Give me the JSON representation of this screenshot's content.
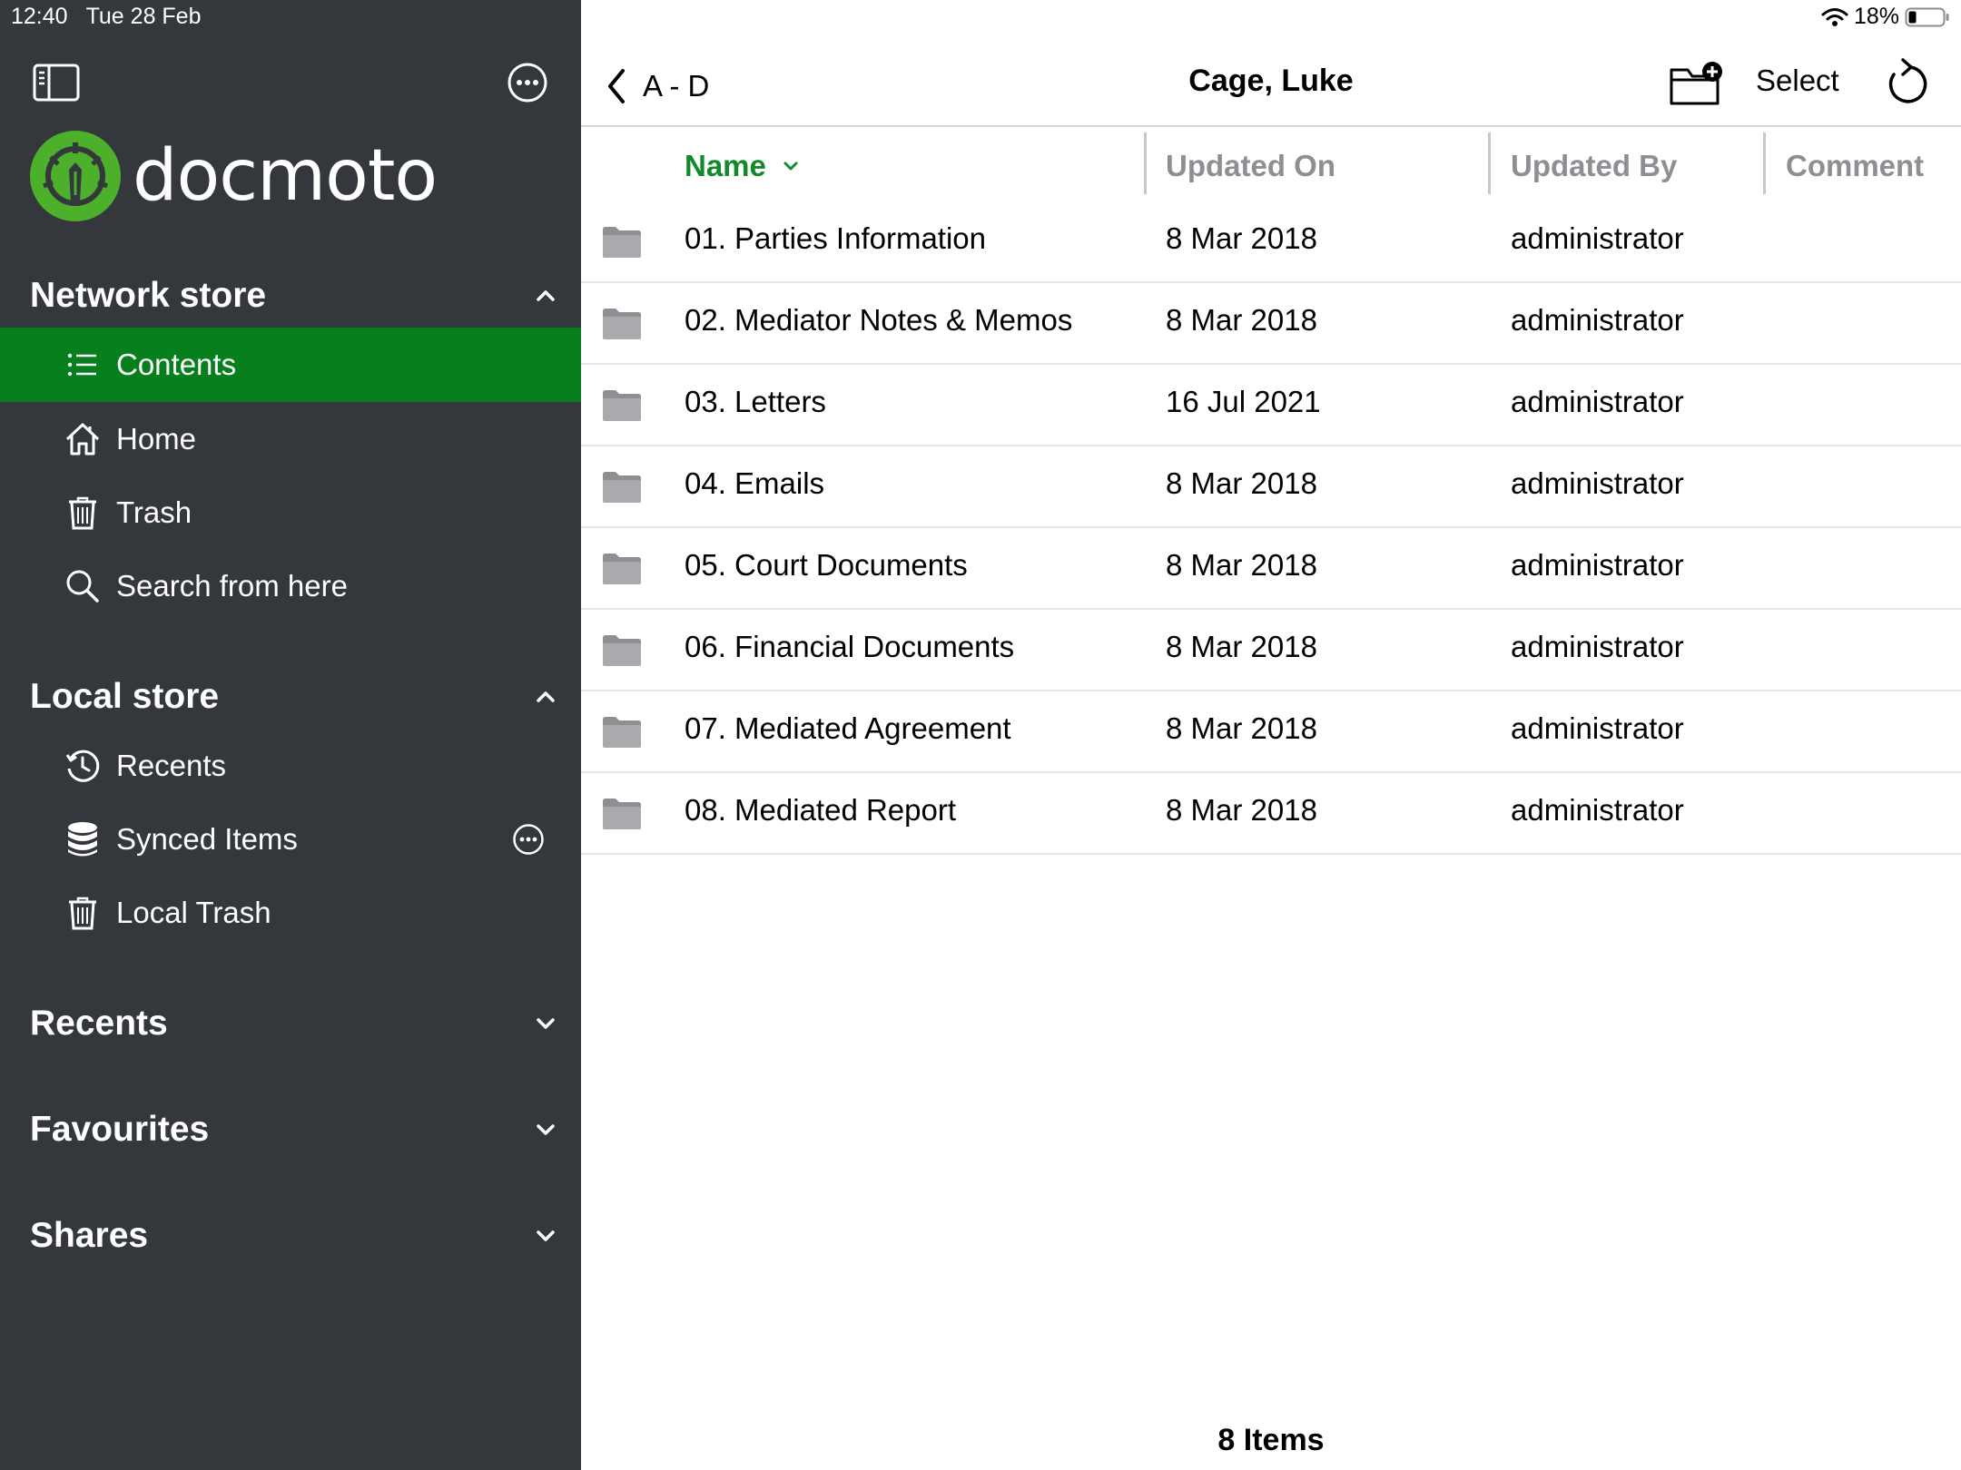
{
  "status": {
    "time": "12:40",
    "date": "Tue 28 Feb",
    "battery": "18%"
  },
  "brand": {
    "name": "docmoto",
    "accent": "#067f1c",
    "sidebar_bg": "#34373c"
  },
  "sidebar": {
    "network_store": {
      "title": "Network store",
      "items": [
        {
          "label": "Contents",
          "icon": "list-icon",
          "active": true
        },
        {
          "label": "Home",
          "icon": "home-icon"
        },
        {
          "label": "Trash",
          "icon": "trash-icon"
        },
        {
          "label": "Search from here",
          "icon": "search-icon"
        }
      ]
    },
    "local_store": {
      "title": "Local store",
      "items": [
        {
          "label": "Recents",
          "icon": "history-icon"
        },
        {
          "label": "Synced Items",
          "icon": "database-icon"
        },
        {
          "label": "Local Trash",
          "icon": "trash-icon"
        }
      ]
    },
    "recents": {
      "title": "Recents"
    },
    "favourites": {
      "title": "Favourites"
    },
    "shares": {
      "title": "Shares"
    }
  },
  "toolbar": {
    "back_label": "A - D",
    "title": "Cage, Luke",
    "select_label": "Select"
  },
  "table": {
    "columns": [
      "Name",
      "Updated On",
      "Updated By",
      "Comment"
    ],
    "sorted_column": "Name",
    "rows": [
      {
        "name": "01. Parties Information",
        "updated_on": "8 Mar 2018",
        "updated_by": "administrator",
        "comment": ""
      },
      {
        "name": "02. Mediator Notes & Memos",
        "updated_on": "8 Mar 2018",
        "updated_by": "administrator",
        "comment": ""
      },
      {
        "name": "03. Letters",
        "updated_on": "16 Jul 2021",
        "updated_by": "administrator",
        "comment": ""
      },
      {
        "name": "04. Emails",
        "updated_on": "8 Mar 2018",
        "updated_by": "administrator",
        "comment": ""
      },
      {
        "name": "05. Court Documents",
        "updated_on": "8 Mar 2018",
        "updated_by": "administrator",
        "comment": ""
      },
      {
        "name": "06. Financial Documents",
        "updated_on": "8 Mar 2018",
        "updated_by": "administrator",
        "comment": ""
      },
      {
        "name": "07. Mediated Agreement",
        "updated_on": "8 Mar 2018",
        "updated_by": "administrator",
        "comment": ""
      },
      {
        "name": "08. Mediated Report",
        "updated_on": "8 Mar 2018",
        "updated_by": "administrator",
        "comment": ""
      }
    ]
  },
  "footer": {
    "item_count": "8 Items"
  }
}
